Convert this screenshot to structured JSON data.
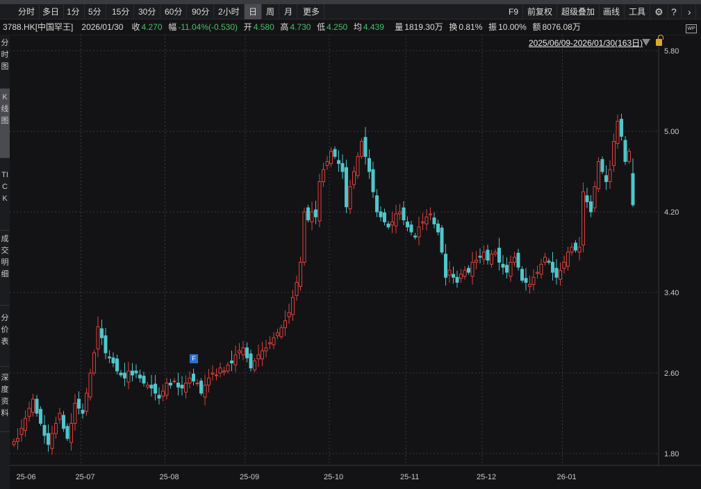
{
  "toolbar": {
    "periods": [
      "分时",
      "多日",
      "1分",
      "5分",
      "15分",
      "30分",
      "60分",
      "90分",
      "2小时",
      "日",
      "周",
      "月",
      "更多"
    ],
    "active": "日",
    "right": [
      "F9",
      "前复权",
      "超级叠加",
      "画线",
      "工具"
    ],
    "icons": [
      "settings-icon",
      "help-icon",
      "chevron-right-icon"
    ]
  },
  "info": {
    "symbol": "3788.HK[中国罕王]",
    "date": "2026/01/30",
    "close_label": "收",
    "close": "4.270",
    "change_label": "幅",
    "change": "-11.04%(-0.530)",
    "open_label": "开",
    "open": "4.580",
    "high_label": "高",
    "high": "4.730",
    "low_label": "低",
    "low": "4.250",
    "avg_label": "均",
    "avg": "4.439",
    "vol_label": "量",
    "vol": "1819.30万",
    "turnover_label": "换",
    "turnover": "0.81%",
    "amp_label": "振",
    "amp": "10.00%",
    "amount_label": "额",
    "amount": "8076.08万"
  },
  "sidebar": [
    "分时图",
    "K线图",
    "TICK",
    "成交明细",
    "分价表",
    "深度资料"
  ],
  "range": "2025/06/09-2026/01/30(163日)",
  "wp_label": "WP",
  "marker_label": "F",
  "colors": {
    "up": "#e0403c",
    "down": "#4fc6cc",
    "grid": "#3a3a3e",
    "bg": "#131315"
  },
  "chart_data": {
    "type": "candlestick",
    "yticks": [
      "5.80",
      "5.00",
      "4.20",
      "3.40",
      "2.60",
      "1.80"
    ],
    "ylim": [
      1.8,
      5.8
    ],
    "xticks": [
      {
        "label": "25-06",
        "index": 3
      },
      {
        "label": "25-07",
        "index": 19
      },
      {
        "label": "25-08",
        "index": 41
      },
      {
        "label": "25-09",
        "index": 62
      },
      {
        "label": "25-10",
        "index": 84
      },
      {
        "label": "25-11",
        "index": 104
      },
      {
        "label": "25-12",
        "index": 124
      },
      {
        "label": "26-01",
        "index": 145
      }
    ],
    "last": {
      "open": 4.58,
      "high": 4.73,
      "low": 4.25,
      "close": 4.27
    },
    "closes": [
      1.92,
      1.95,
      2.05,
      2.15,
      2.25,
      2.34,
      2.2,
      2.1,
      1.98,
      1.89,
      2.0,
      2.1,
      2.2,
      2.05,
      1.95,
      2.1,
      2.3,
      2.25,
      2.2,
      2.4,
      2.6,
      2.8,
      3.06,
      2.95,
      2.8,
      2.75,
      2.7,
      2.62,
      2.58,
      2.55,
      2.62,
      2.58,
      2.6,
      2.55,
      2.5,
      2.48,
      2.45,
      2.4,
      2.35,
      2.42,
      2.5,
      2.48,
      2.52,
      2.46,
      2.45,
      2.5,
      2.55,
      2.52,
      2.5,
      2.4,
      2.48,
      2.55,
      2.6,
      2.58,
      2.65,
      2.62,
      2.68,
      2.7,
      2.78,
      2.82,
      2.85,
      2.75,
      2.65,
      2.72,
      2.78,
      2.82,
      2.85,
      2.9,
      2.95,
      3.0,
      3.05,
      3.12,
      3.2,
      3.35,
      3.5,
      3.7,
      4.2,
      4.12,
      4.2,
      4.15,
      4.5,
      4.62,
      4.7,
      4.8,
      4.75,
      4.68,
      4.6,
      4.25,
      4.45,
      4.6,
      4.75,
      4.9,
      4.75,
      4.6,
      4.4,
      4.2,
      4.15,
      4.1,
      4.05,
      4.1,
      4.18,
      4.2,
      4.12,
      4.05,
      4.0,
      3.95,
      4.05,
      4.1,
      4.15,
      4.18,
      4.08,
      4.0,
      3.8,
      3.55,
      3.62,
      3.55,
      3.5,
      3.58,
      3.62,
      3.6,
      3.7,
      3.72,
      3.75,
      3.8,
      3.72,
      3.78,
      3.8,
      3.7,
      3.65,
      3.6,
      3.7,
      3.75,
      3.65,
      3.52,
      3.5,
      3.48,
      3.55,
      3.6,
      3.68,
      3.75,
      3.7,
      3.6,
      3.55,
      3.62,
      3.7,
      3.8,
      3.85,
      3.82,
      3.85,
      4.4,
      4.3,
      4.2,
      4.45,
      4.7,
      4.6,
      4.5,
      4.62,
      4.9,
      5.1,
      4.95,
      4.7,
      4.8,
      4.27
    ]
  }
}
